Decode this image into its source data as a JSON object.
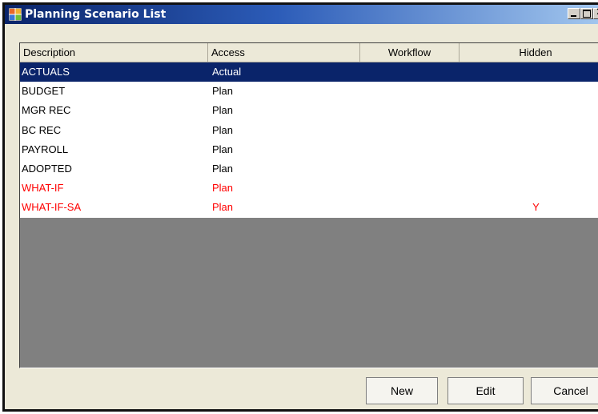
{
  "window": {
    "title": "Planning Scenario List",
    "close_glyph": "✕",
    "icon": "app-grid-icon"
  },
  "grid": {
    "columns": [
      "Description",
      "Access",
      "Workflow",
      "Hidden"
    ],
    "rows": [
      {
        "description": "ACTUALS",
        "access": "Actual",
        "workflow": "",
        "hidden": "",
        "selected": true,
        "red": false
      },
      {
        "description": "BUDGET",
        "access": "Plan",
        "workflow": "",
        "hidden": "",
        "selected": false,
        "red": false
      },
      {
        "description": "MGR REC",
        "access": "Plan",
        "workflow": "",
        "hidden": "",
        "selected": false,
        "red": false
      },
      {
        "description": "BC REC",
        "access": "Plan",
        "workflow": "",
        "hidden": "",
        "selected": false,
        "red": false
      },
      {
        "description": "PAYROLL",
        "access": "Plan",
        "workflow": "",
        "hidden": "",
        "selected": false,
        "red": false
      },
      {
        "description": "ADOPTED",
        "access": "Plan",
        "workflow": "",
        "hidden": "",
        "selected": false,
        "red": false
      },
      {
        "description": "WHAT-IF",
        "access": "Plan",
        "workflow": "",
        "hidden": "",
        "selected": false,
        "red": true
      },
      {
        "description": "WHAT-IF-SA",
        "access": "Plan",
        "workflow": "",
        "hidden": "Y",
        "selected": false,
        "red": true
      }
    ]
  },
  "buttons": {
    "new_label": "New",
    "edit_label": "Edit",
    "cancel_label": "Cancel"
  },
  "colors": {
    "selection": "#0a246a",
    "hidden_row_text": "#ff0000",
    "empty_area": "#808080"
  }
}
